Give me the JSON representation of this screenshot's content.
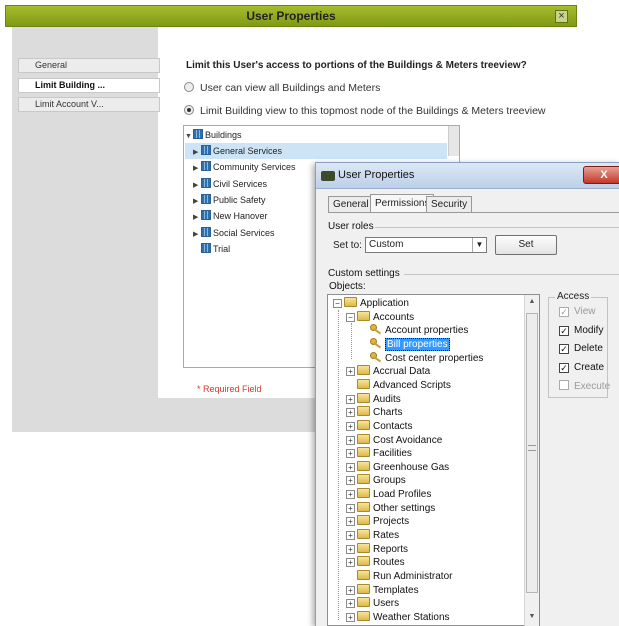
{
  "web_dialog": {
    "title": "User Properties",
    "close_icon": "close-icon",
    "nav": [
      {
        "label": "General"
      },
      {
        "label": "Limit Building ..."
      },
      {
        "label": "Limit Account V..."
      }
    ],
    "heading": "Limit this User's access to portions of the Buildings & Meters treeview?",
    "options": [
      {
        "label": "User can view all Buildings and Meters",
        "selected": false
      },
      {
        "label": "Limit Building view to this topmost node of the Buildings & Meters treeview",
        "selected": true
      }
    ],
    "tree": {
      "root": "Buildings",
      "children": [
        "General Services",
        "Community Services",
        "Civil Services",
        "Public Safety",
        "New Hanover",
        "Social Services",
        "Trial"
      ]
    },
    "required_note": "* Required Field",
    "colors": {
      "title_bar": "#8fa91d",
      "selection": "#cde4f7",
      "required": "#d13b2b"
    }
  },
  "win_dialog": {
    "title": "User Properties",
    "close_label": "X",
    "tabs": [
      "General",
      "Permissions",
      "Security"
    ],
    "active_tab": "Permissions",
    "user_roles_label": "User roles",
    "set_to_label": "Set to:",
    "set_to_value": "Custom",
    "set_button": "Set",
    "custom_settings_label": "Custom settings",
    "objects_label": "Objects:",
    "objects": [
      {
        "label": "Application",
        "level": 0,
        "expander": "−",
        "icon": "folder-icon"
      },
      {
        "label": "Accounts",
        "level": 1,
        "expander": "−",
        "icon": "folder-icon"
      },
      {
        "label": "Account properties",
        "level": 2,
        "expander": "",
        "icon": "key-icon"
      },
      {
        "label": "Bill properties",
        "level": 2,
        "expander": "",
        "icon": "key-icon",
        "selected": true
      },
      {
        "label": "Cost center properties",
        "level": 2,
        "expander": "",
        "icon": "key-icon"
      },
      {
        "label": "Accrual Data",
        "level": 1,
        "expander": "+",
        "icon": "folder-icon"
      },
      {
        "label": "Advanced Scripts",
        "level": 1,
        "expander": "",
        "icon": "folder-icon"
      },
      {
        "label": "Audits",
        "level": 1,
        "expander": "+",
        "icon": "folder-icon"
      },
      {
        "label": "Charts",
        "level": 1,
        "expander": "+",
        "icon": "folder-icon"
      },
      {
        "label": "Contacts",
        "level": 1,
        "expander": "+",
        "icon": "folder-icon"
      },
      {
        "label": "Cost Avoidance",
        "level": 1,
        "expander": "+",
        "icon": "folder-icon"
      },
      {
        "label": "Facilities",
        "level": 1,
        "expander": "+",
        "icon": "folder-icon"
      },
      {
        "label": "Greenhouse Gas",
        "level": 1,
        "expander": "+",
        "icon": "folder-icon"
      },
      {
        "label": "Groups",
        "level": 1,
        "expander": "+",
        "icon": "folder-icon"
      },
      {
        "label": "Load Profiles",
        "level": 1,
        "expander": "+",
        "icon": "folder-icon"
      },
      {
        "label": "Other settings",
        "level": 1,
        "expander": "+",
        "icon": "folder-icon"
      },
      {
        "label": "Projects",
        "level": 1,
        "expander": "+",
        "icon": "folder-icon"
      },
      {
        "label": "Rates",
        "level": 1,
        "expander": "+",
        "icon": "folder-icon"
      },
      {
        "label": "Reports",
        "level": 1,
        "expander": "+",
        "icon": "folder-icon"
      },
      {
        "label": "Routes",
        "level": 1,
        "expander": "+",
        "icon": "folder-icon"
      },
      {
        "label": "Run Administrator",
        "level": 1,
        "expander": "",
        "icon": "folder-icon"
      },
      {
        "label": "Templates",
        "level": 1,
        "expander": "+",
        "icon": "folder-icon"
      },
      {
        "label": "Users",
        "level": 1,
        "expander": "+",
        "icon": "folder-icon"
      },
      {
        "label": "Weather Stations",
        "level": 1,
        "expander": "+",
        "icon": "folder-icon"
      }
    ],
    "access_label": "Access",
    "access": [
      {
        "label": "View",
        "checked": true,
        "enabled": false
      },
      {
        "label": "Modify",
        "checked": true,
        "enabled": true
      },
      {
        "label": "Delete",
        "checked": true,
        "enabled": true
      },
      {
        "label": "Create",
        "checked": true,
        "enabled": true
      },
      {
        "label": "Execute",
        "checked": false,
        "enabled": false
      }
    ],
    "colors": {
      "selection": "#3399ff",
      "title_bar": "#c8d9ee",
      "close": "#c0392b"
    }
  }
}
